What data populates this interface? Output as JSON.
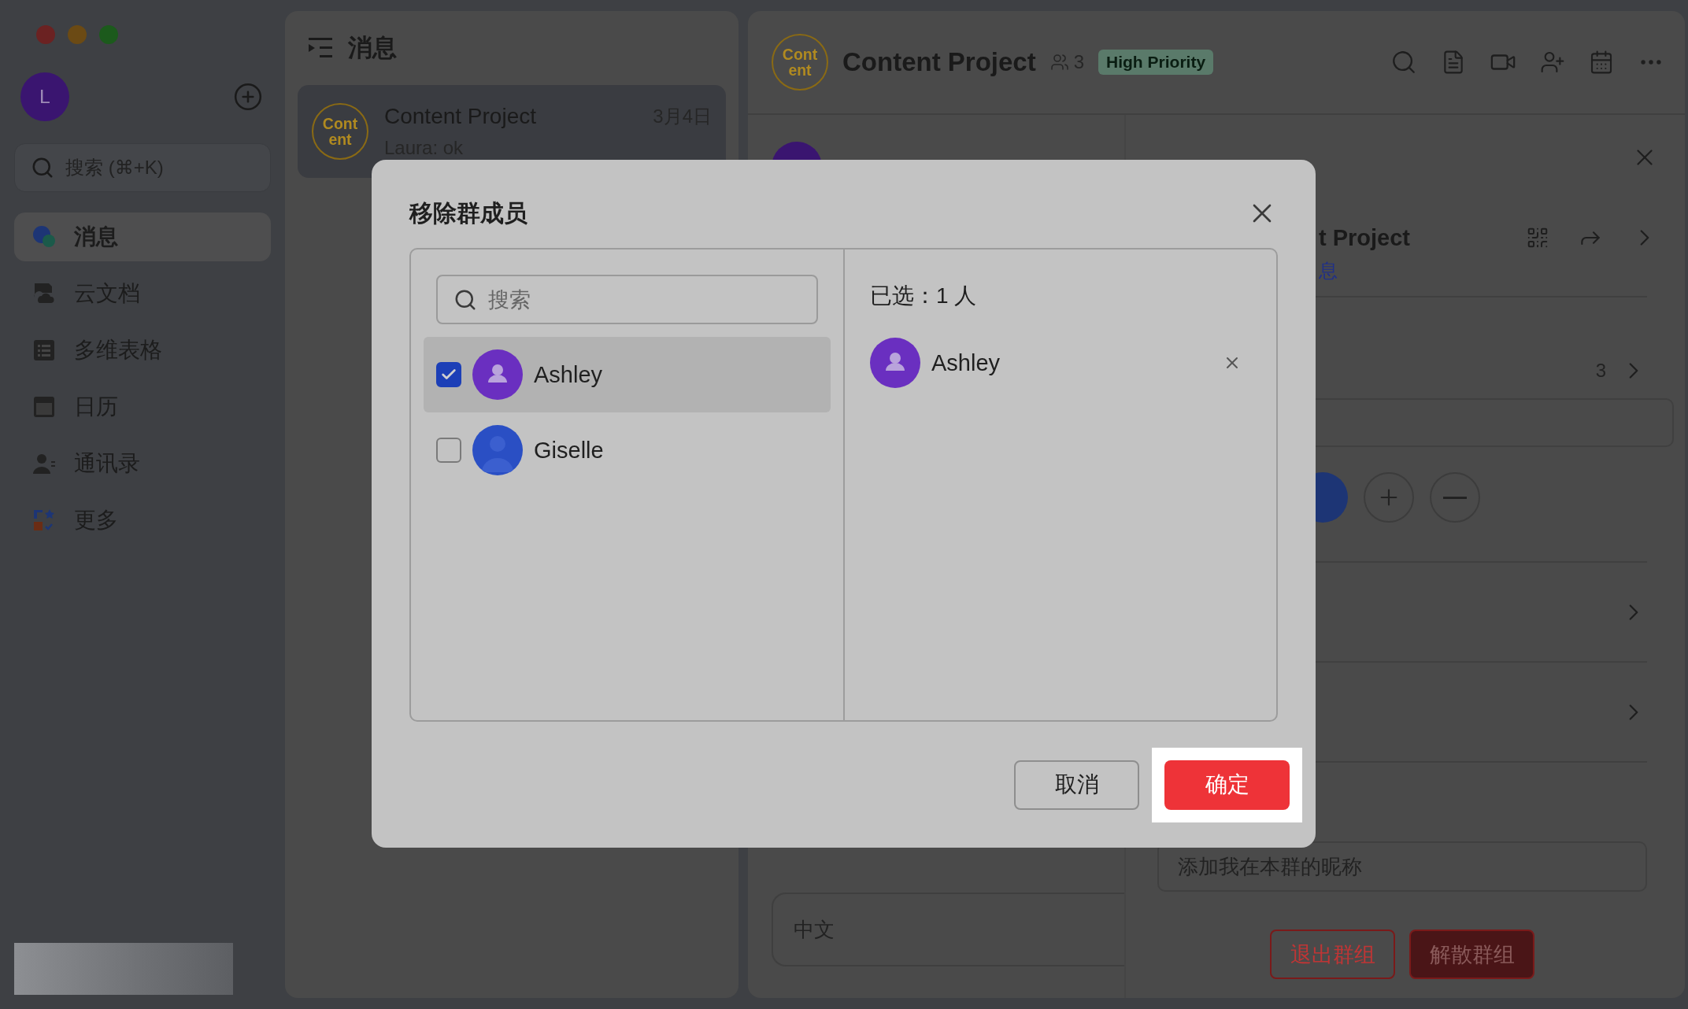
{
  "sidebar": {
    "avatar": "L",
    "search": {
      "placeholder": "搜索 (⌘+K)"
    },
    "nav": [
      {
        "label": "消息",
        "kind": "messages",
        "selected": true
      },
      {
        "label": "云文档",
        "kind": "docs",
        "selected": false
      },
      {
        "label": "多维表格",
        "kind": "table",
        "selected": false
      },
      {
        "label": "日历",
        "kind": "calendar",
        "selected": false
      },
      {
        "label": "通讯录",
        "kind": "contacts",
        "selected": false
      },
      {
        "label": "更多",
        "kind": "more",
        "selected": false
      }
    ]
  },
  "conversation_list": {
    "title": "消息",
    "items": [
      {
        "avatar_lines": [
          "Cont",
          "ent"
        ],
        "title": "Content Project",
        "date": "3月4日",
        "preview": "Laura: ok",
        "selected": true
      }
    ]
  },
  "chat": {
    "avatar_lines": [
      "Cont",
      "ent"
    ],
    "title": "Content Project",
    "member_count": "3",
    "tag": "High Priority",
    "input": {
      "placeholder": "中文"
    }
  },
  "settings": {
    "group_name": "t Project",
    "group_link": "息",
    "member_count": "3",
    "nickname": {
      "placeholder": "添加我在本群的昵称"
    },
    "buttons": [
      {
        "label": "退出群组",
        "kind": "outline"
      },
      {
        "label": "解散群组",
        "kind": "danger"
      }
    ]
  },
  "dialog": {
    "title": "移除群成员",
    "search": {
      "placeholder": "搜索"
    },
    "members": [
      {
        "name": "Ashley",
        "kind": "icon",
        "color": "#6a2fc0",
        "checked": true
      },
      {
        "name": "Giselle",
        "kind": "silhouette",
        "color": "#2a4fc4",
        "checked": false
      }
    ],
    "selected_label": "已选：1 人",
    "selected_members": [
      {
        "name": "Ashley",
        "kind": "icon",
        "color": "#6a2fc0"
      }
    ],
    "buttons": [
      {
        "label": "取消",
        "kind": "secondary",
        "highlighted": false
      },
      {
        "label": "确定",
        "kind": "primary",
        "highlighted": true
      }
    ]
  }
}
